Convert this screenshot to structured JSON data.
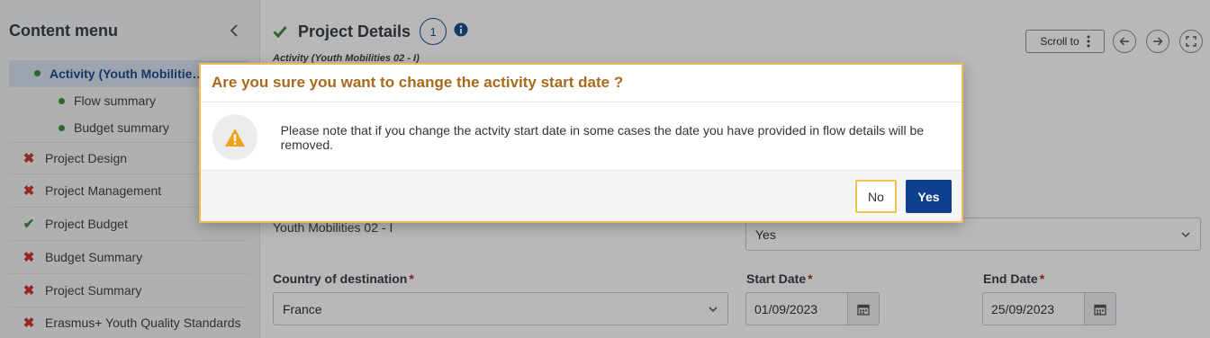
{
  "sidebar": {
    "title": "Content menu",
    "active_item": "Activity (Youth Mobilitie…",
    "active_suffix": "(",
    "sub_items": [
      "Flow summary",
      "Budget summary"
    ],
    "items": [
      {
        "label": "Project Design",
        "status": "error"
      },
      {
        "label": "Project Management",
        "status": "error"
      },
      {
        "label": "Project Budget",
        "status": "ok"
      },
      {
        "label": "Budget Summary",
        "status": "error"
      },
      {
        "label": "Project Summary",
        "status": "error"
      },
      {
        "label": "Erasmus+ Youth Quality Standards",
        "status": "error"
      }
    ]
  },
  "header": {
    "title": "Project Details",
    "step": "1",
    "subtitle": "Activity (Youth Mobilities 02 - I)",
    "scroll_to": "Scroll to"
  },
  "form": {
    "activity_value": "Youth Mobilities 02 - I",
    "yes_select_value": "Yes",
    "country_label": "Country of destination",
    "country_value": "France",
    "start_label": "Start Date",
    "start_value": "01/09/2023",
    "end_label": "End Date",
    "end_value": "25/09/2023",
    "required_mark": "*"
  },
  "modal": {
    "title": "Are you sure you want to change the activity start date ?",
    "message": "Please note that if you change the actvity start date in some cases the date you have provided in flow details will be removed.",
    "no_label": "No",
    "yes_label": "Yes"
  },
  "colors": {
    "accent": "#1d4f91",
    "warning": "#f0a21b",
    "error": "#d03a2f",
    "success": "#3f8f3f",
    "primary_button": "#0e3f8c"
  }
}
